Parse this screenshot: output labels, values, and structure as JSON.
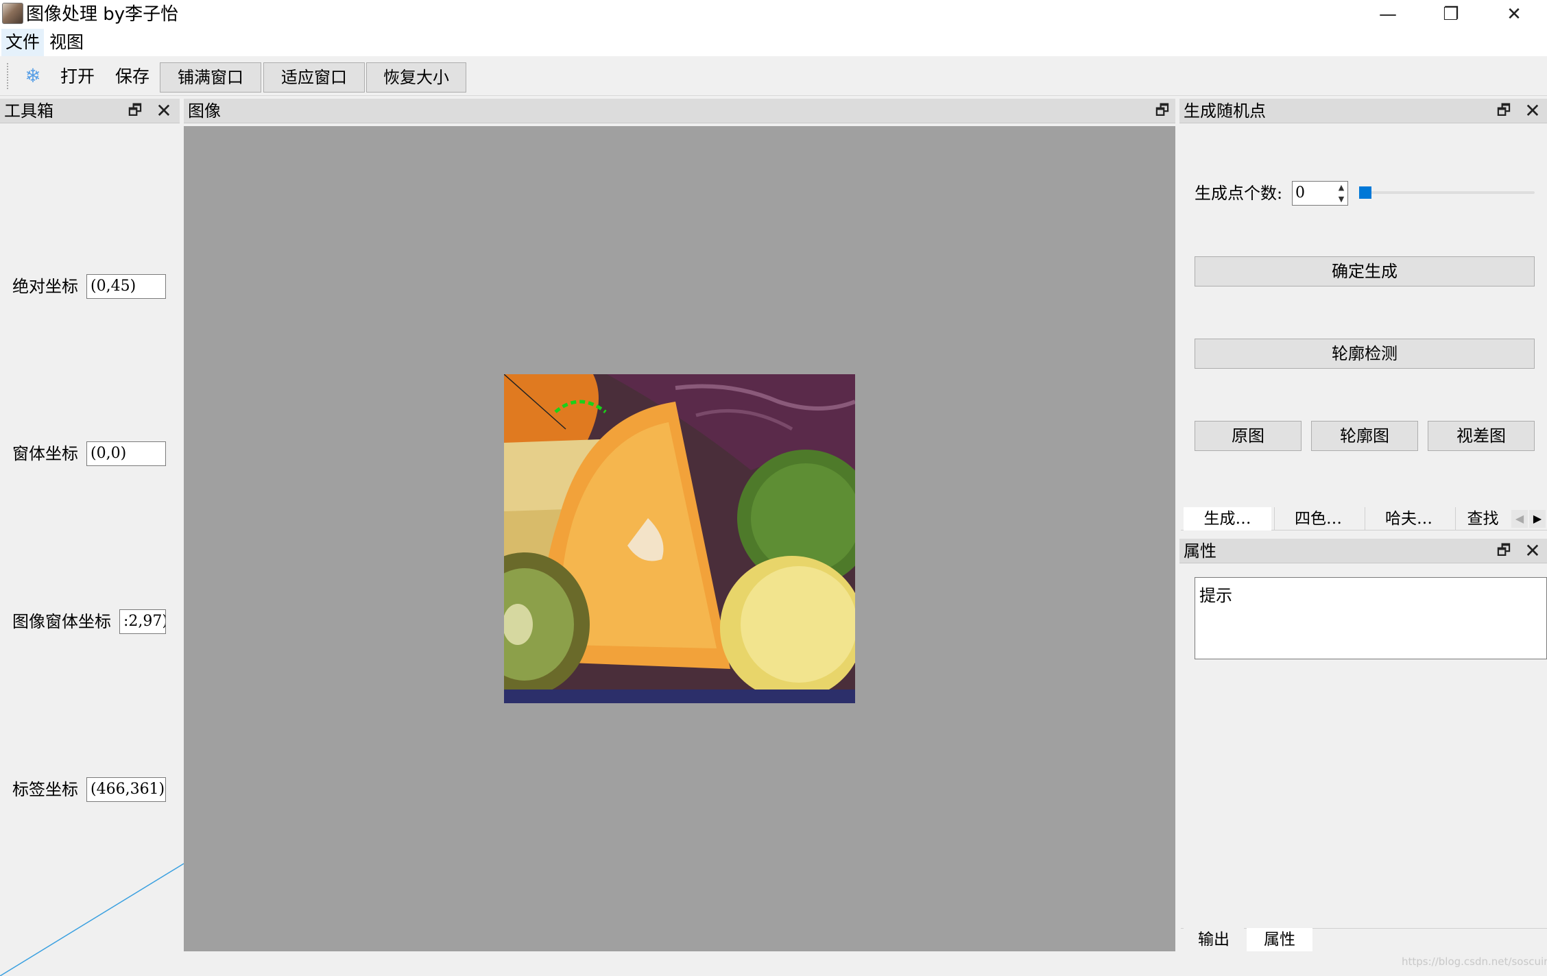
{
  "window": {
    "title": "图像处理 by李子怡",
    "minimize_glyph": "—",
    "maximize_glyph": "❐",
    "close_glyph": "✕"
  },
  "menu": [
    "文件",
    "视图"
  ],
  "toolbar": {
    "icon": "snowflake-icon",
    "icon_glyph": "❄",
    "open_label": "打开",
    "save_label": "保存",
    "fill_window_label": "铺满窗口",
    "fit_window_label": "适应窗口",
    "restore_size_label": "恢复大小"
  },
  "toolbox": {
    "title": "工具箱",
    "absolute_coord_label": "绝对坐标",
    "absolute_coord_value": "(0,45)",
    "window_coord_label": "窗体坐标",
    "window_coord_value": "(0,0)",
    "image_window_coord_label": "图像窗体坐标",
    "image_window_coord_value": ":2,97)",
    "label_coord_label": "标签坐标",
    "label_coord_value": "(466,361)"
  },
  "image_dock": {
    "title": "图像"
  },
  "random_points": {
    "title": "生成随机点",
    "count_label": "生成点个数:",
    "count_value": "0",
    "generate_label": "确定生成",
    "contour_detect_label": "轮廓检测",
    "original_label": "原图",
    "contour_image_label": "轮廓图",
    "disparity_label": "视差图"
  },
  "tool_tabs": [
    "生成…",
    "四色…",
    "哈夫…",
    "查找"
  ],
  "properties": {
    "title": "属性",
    "hint_text": "提示"
  },
  "bottom_tabs": [
    "输出",
    "属性"
  ],
  "watermark": "https://blog.csdn.net/soscuim",
  "colors": {
    "accent": "#0078d7",
    "image_bg": "#a0a0a0",
    "contour": "#19d219"
  }
}
